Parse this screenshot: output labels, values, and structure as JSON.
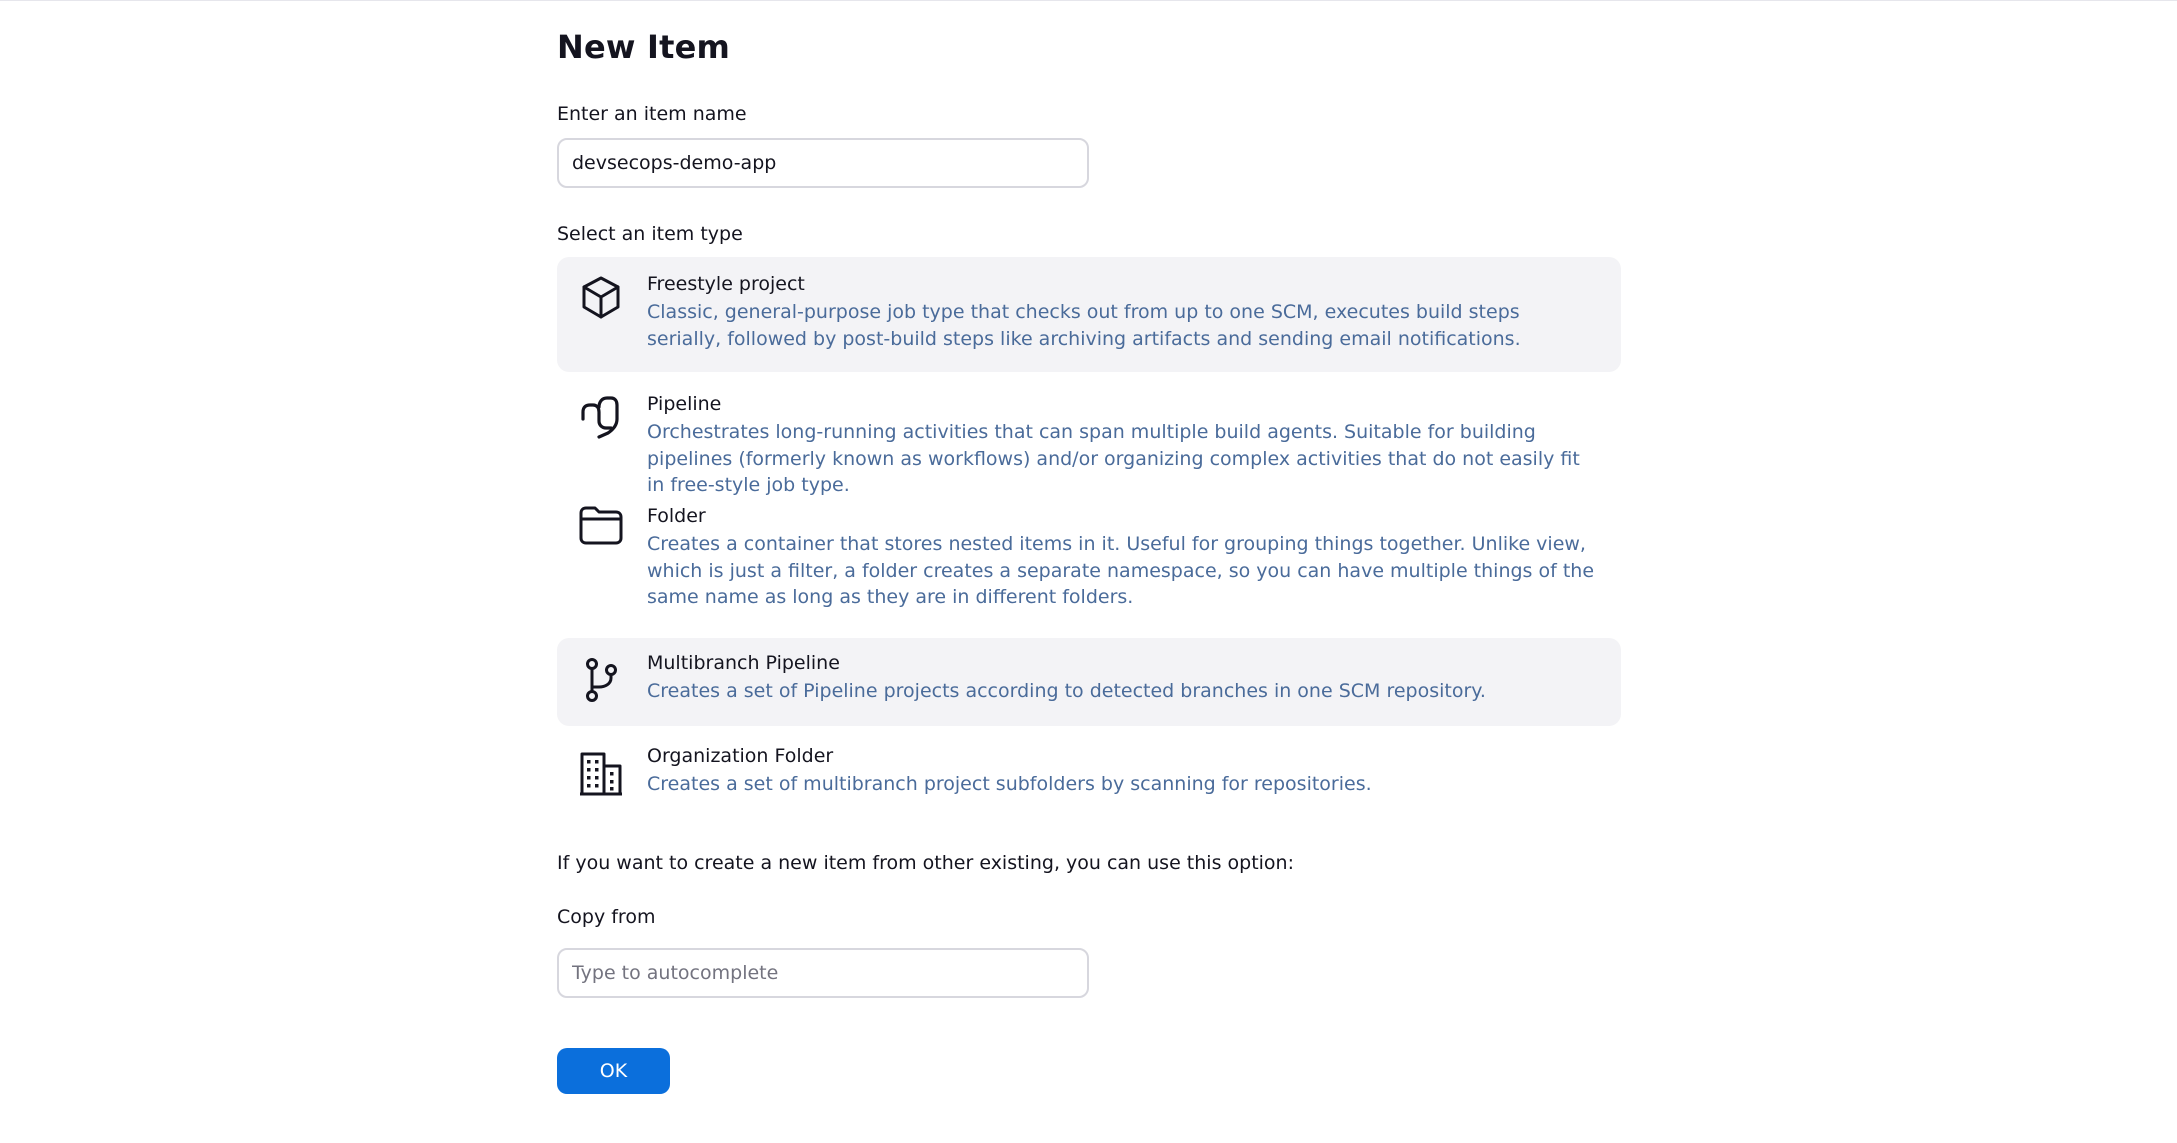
{
  "page": {
    "title": "New Item"
  },
  "name_field": {
    "label": "Enter an item name",
    "value": "devsecops-demo-app"
  },
  "types": {
    "label": "Select an item type",
    "items": [
      {
        "name": "Freestyle project",
        "description": "Classic, general-purpose job type that checks out from up to one SCM, executes build steps serially, followed by post-build steps like archiving artifacts and sending email notifications.",
        "icon": "cube-icon"
      },
      {
        "name": "Pipeline",
        "description": "Orchestrates long-running activities that can span multiple build agents. Suitable for building pipelines (formerly known as workflows) and/or organizing complex activities that do not easily fit in free-style job type.",
        "icon": "pipeline-icon"
      },
      {
        "name": "Folder",
        "description": "Creates a container that stores nested items in it. Useful for grouping things together. Unlike view, which is just a filter, a folder creates a separate namespace, so you can have multiple things of the same name as long as they are in different folders.",
        "icon": "folder-icon"
      },
      {
        "name": "Multibranch Pipeline",
        "description": "Creates a set of Pipeline projects according to detected branches in one SCM repository.",
        "icon": "git-branch-icon"
      },
      {
        "name": "Organization Folder",
        "description": "Creates a set of multibranch project subfolders by scanning for repositories.",
        "icon": "building-icon"
      }
    ]
  },
  "copy": {
    "hint": "If you want to create a new item from other existing, you can use this option:",
    "label": "Copy from",
    "placeholder": "Type to autocomplete",
    "value": ""
  },
  "actions": {
    "ok_label": "OK"
  },
  "colors": {
    "accent": "#0b6fdc",
    "description_text": "#4a6b9a",
    "selected_bg": "#f3f3f6"
  }
}
